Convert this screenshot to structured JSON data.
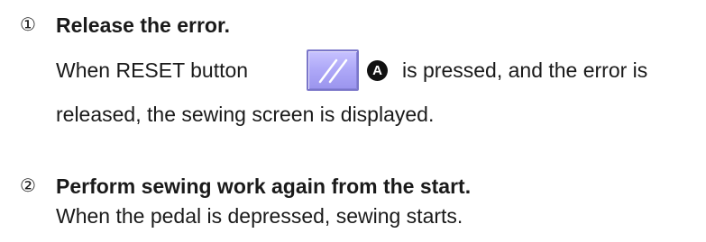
{
  "steps": [
    {
      "number": "①",
      "title": "Release the error.",
      "line1_before": "When RESET button",
      "line1_after": "is pressed, and the error is",
      "line2": "released, the sewing screen is displayed.",
      "button_icon": "reset-slash-icon",
      "badge": "A"
    },
    {
      "number": "②",
      "title": "Perform sewing work again from the start.",
      "line1": "When the pedal is depressed, sewing starts."
    }
  ],
  "colors": {
    "button_face": "#ada7f7",
    "button_border": "#7a76c9",
    "badge_bg": "#111111",
    "text": "#1a1a1a"
  }
}
